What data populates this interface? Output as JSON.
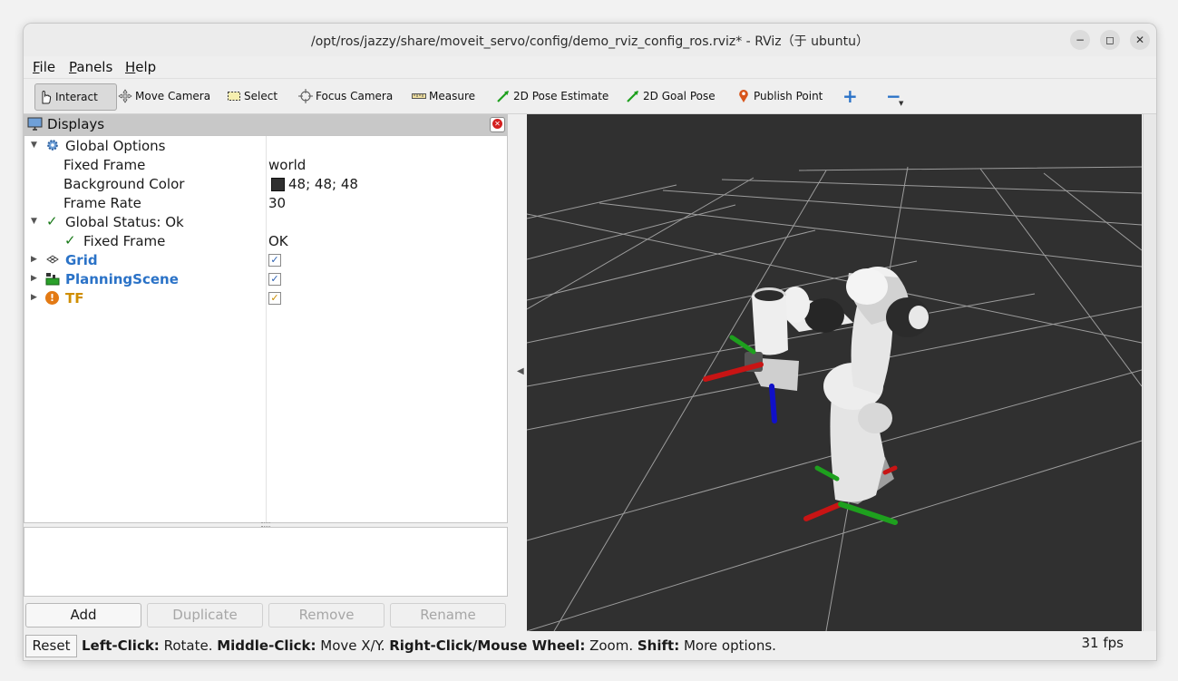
{
  "window": {
    "title": "/opt/ros/jazzy/share/moveit_servo/config/demo_rviz_config_ros.rviz* - RViz（于 ubuntu）",
    "minimize": "−",
    "maximize": "◻",
    "close": "✕"
  },
  "menu": [
    {
      "key": "F",
      "rest": "ile"
    },
    {
      "key": "P",
      "rest": "anels"
    },
    {
      "key": "H",
      "rest": "elp"
    }
  ],
  "toolbar": {
    "interact": "Interact",
    "move_camera": "Move Camera",
    "select": "Select",
    "focus_camera": "Focus Camera",
    "measure": "Measure",
    "pose_estimate": "2D Pose Estimate",
    "goal_pose": "2D Goal Pose",
    "publish_point": "Publish Point",
    "add_tool": "+",
    "remove_tool": "−"
  },
  "displays": {
    "title": "Displays",
    "global_options": "Global Options",
    "fixed_frame_label": "Fixed Frame",
    "fixed_frame_value": "world",
    "bg_color_label": "Background Color",
    "bg_color_value": "48; 48; 48",
    "bg_color_swatch": "#303030",
    "frame_rate_label": "Frame Rate",
    "frame_rate_value": "30",
    "global_status": "Global Status: Ok",
    "status_fixed_frame_label": "Fixed Frame",
    "status_fixed_frame_value": "OK",
    "grid": "Grid",
    "planning_scene": "PlanningScene",
    "tf": "TF",
    "check": "✓"
  },
  "buttons": {
    "add": "Add",
    "duplicate": "Duplicate",
    "remove": "Remove",
    "rename": "Rename"
  },
  "status": {
    "reset": "Reset",
    "left_click_key": "Left-Click:",
    "left_click_val": " Rotate. ",
    "middle_click_key": "Middle-Click:",
    "middle_click_val": " Move X/Y. ",
    "right_click_key": "Right-Click/Mouse Wheel:",
    "right_click_val": " Zoom. ",
    "shift_key": "Shift:",
    "shift_val": " More options.",
    "fps": "31 fps"
  },
  "colors": {
    "viewport_bg": "#303030",
    "link_blue": "#2a72c7",
    "warn_gold": "#d08e00",
    "axis_red": "#c81414",
    "axis_green": "#1ea01e",
    "axis_blue": "#1010c8"
  }
}
